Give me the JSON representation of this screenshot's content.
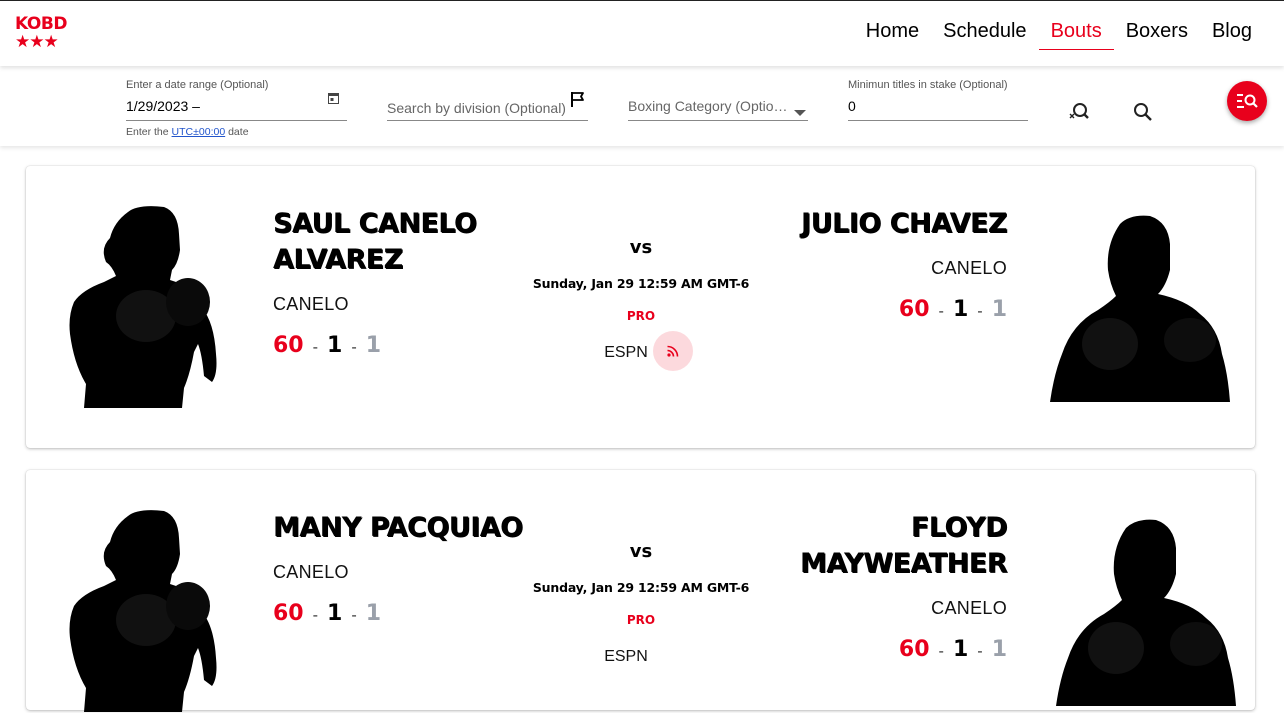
{
  "brand": {
    "logo_text": "KOBD",
    "logo_stars": "★★★"
  },
  "nav": {
    "items": [
      {
        "label": "Home"
      },
      {
        "label": "Schedule"
      },
      {
        "label": "Bouts"
      },
      {
        "label": "Boxers"
      },
      {
        "label": "Blog"
      }
    ],
    "active": "Bouts"
  },
  "filters": {
    "date_range": {
      "label": "Enter a date range (Optional)",
      "value": "1/29/2023 –",
      "hint_prefix": "Enter the",
      "hint_link": "UTC±00:00",
      "hint_suffix": "date"
    },
    "division": {
      "placeholder": "Search by division (Optional)"
    },
    "category": {
      "placeholder": "Boxing Category (Optional)"
    },
    "titles": {
      "label": "Minimun titles in stake (Optional)",
      "value": "0"
    }
  },
  "colors": {
    "accent": "#e8001c",
    "draw_gray": "#9aa0aa"
  },
  "bouts": [
    {
      "left": {
        "name_line1": "SAUL CANELO",
        "name_line2": "ALVAREZ",
        "nickname": "CANELO",
        "wins": "60",
        "losses": "1",
        "draws": "1"
      },
      "right": {
        "name_line1": "JULIO CHAVEZ",
        "nickname": "CANELO",
        "wins": "60",
        "losses": "1",
        "draws": "1"
      },
      "vs": "vs",
      "date": "Sunday, Jan 29 12:59 AM GMT-6",
      "type": "PRO",
      "network": "ESPN",
      "separator": "-"
    },
    {
      "left": {
        "name_line1": "MANY PACQUIAO",
        "nickname": "CANELO",
        "wins": "60",
        "losses": "1",
        "draws": "1"
      },
      "right": {
        "name_line1": "FLOYD",
        "name_line2": "MAYWEATHER",
        "nickname": "CANELO",
        "wins": "60",
        "losses": "1",
        "draws": "1"
      },
      "vs": "vs",
      "date": "Sunday, Jan 29 12:59 AM GMT-6",
      "type": "PRO",
      "network": "ESPN",
      "separator": "-"
    }
  ]
}
